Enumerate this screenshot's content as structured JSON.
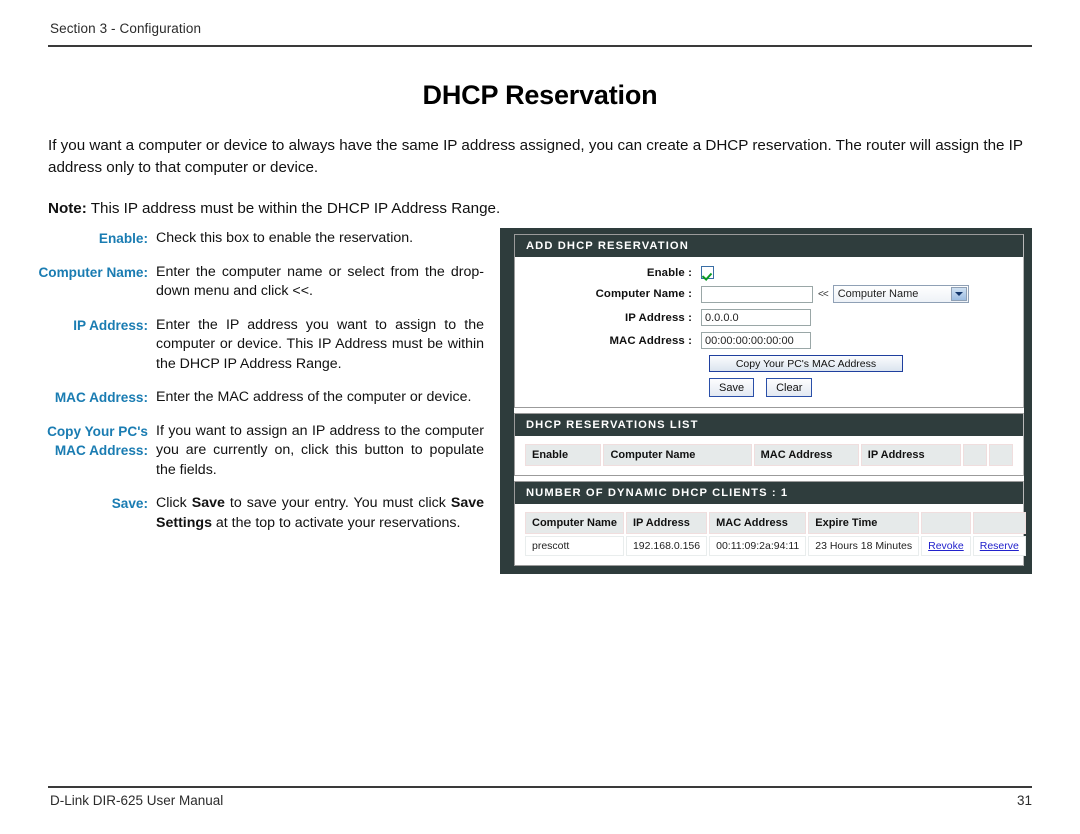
{
  "header": {
    "section": "Section 3 - Configuration",
    "title": "DHCP Reservation"
  },
  "intro": {
    "paragraph": "If you want a computer or device to always have the same IP address assigned, you can create a DHCP reservation. The router will assign the IP address only to that computer or device.",
    "note_label": "Note:",
    "note_text": " This IP address must be within the DHCP IP Address Range."
  },
  "definitions": [
    {
      "term": "Enable:",
      "desc": "Check this box to enable the reservation."
    },
    {
      "term": "Computer Name:",
      "desc": "Enter the computer name or select from the drop-down menu and click <<."
    },
    {
      "term": "IP Address:",
      "desc": "Enter the IP address you want to assign to the computer or device. This IP Address must be within the DHCP IP Address Range."
    },
    {
      "term": "MAC Address:",
      "desc": "Enter the MAC address of the computer or device."
    },
    {
      "term": "Copy Your PC's",
      "term2": "MAC Address:",
      "desc": "If you want to assign an IP address to the computer you are currently on, click this button to populate the fields."
    },
    {
      "term": "Save:",
      "desc_pre": "Click ",
      "desc_b1": "Save",
      "desc_mid": " to save your entry. You must click ",
      "desc_b2": "Save Settings",
      "desc_post": " at the top to activate your reservations."
    }
  ],
  "screenshot": {
    "add_panel": {
      "title": "ADD DHCP RESERVATION",
      "enable_label": "Enable :",
      "enable_checked": true,
      "computer_name_label": "Computer Name :",
      "computer_name_value": "",
      "arrow_symbol": "<<",
      "computer_name_select": "Computer Name",
      "ip_label": "IP Address :",
      "ip_value": "0.0.0.0",
      "mac_label": "MAC Address :",
      "mac_value": "00:00:00:00:00:00",
      "copy_mac_button": "Copy Your PC's MAC Address",
      "save_button": "Save",
      "clear_button": "Clear"
    },
    "reservations_panel": {
      "title": "DHCP RESERVATIONS LIST",
      "columns": [
        "Enable",
        "Computer Name",
        "MAC Address",
        "IP Address",
        "",
        ""
      ],
      "rows": []
    },
    "clients_panel": {
      "title": "NUMBER OF DYNAMIC DHCP CLIENTS : 1",
      "columns": [
        "Computer Name",
        "IP Address",
        "MAC Address",
        "Expire Time",
        "",
        ""
      ],
      "rows": [
        {
          "computer_name": "prescott",
          "ip_address": "192.168.0.156",
          "mac_address": "00:11:09:2a:94:11",
          "expire_time": "23 Hours 18 Minutes",
          "revoke": "Revoke",
          "reserve": "Reserve"
        }
      ]
    }
  },
  "footer": {
    "left": "D-Link DIR-625 User Manual",
    "page": "31"
  },
  "colors": {
    "term_blue": "#1a7cb2",
    "panel_header_bg": "#2f3d3d",
    "frame": "#2e3c3c",
    "link": "#2222cc",
    "check_green": "#0a9a22"
  }
}
